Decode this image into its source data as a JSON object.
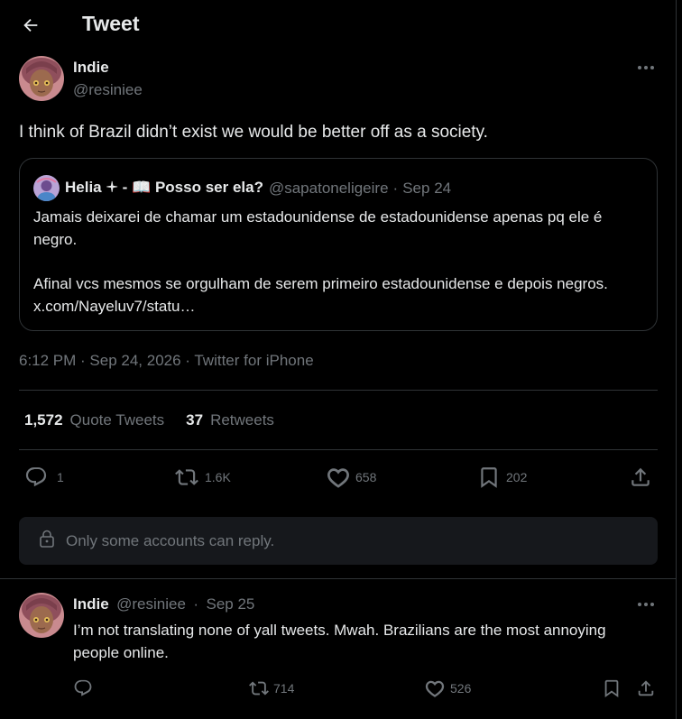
{
  "header": {
    "title": "Tweet"
  },
  "main_tweet": {
    "name": "Indie",
    "handle": "@resiniee",
    "text": "I think of Brazil didn’t exist we would be better off as a society.",
    "quote": {
      "name": "Helia 🟄 - 📖 Posso ser ela?",
      "handle": "@sapatoneligeire",
      "date": "Sep 24",
      "paragraph1": "Jamais deixarei de chamar um estadounidense de estadounidense apenas pq ele é negro.",
      "paragraph2": "Afinal vcs mesmos se orgulham de serem primeiro estadounidense e depois negros. x.com/Nayeluv7/statu…"
    },
    "timestamp": "6:12 PM · Sep 24, 2026 · Twitter for iPhone",
    "stats": {
      "quote_count": "1,572",
      "quote_label": "Quote Tweets",
      "retweet_count": "37",
      "retweet_label": "Retweets"
    },
    "actions": {
      "replies": "1",
      "retweets": "1.6K",
      "likes": "658",
      "bookmarks": "202"
    },
    "reply_restriction": "Only some accounts can reply."
  },
  "reply_tweet": {
    "name": "Indie",
    "handle": "@resiniee",
    "date": "Sep 25",
    "text": "I’m not translating none of yall tweets. Mwah. Brazilians are the most annoying people online.",
    "actions": {
      "retweets": "714",
      "likes": "526"
    }
  },
  "colors": {
    "background": "#000000",
    "text": "#e7e9ea",
    "secondary": "#71767b",
    "border": "#2f3336",
    "reply_box": "#16181c"
  }
}
